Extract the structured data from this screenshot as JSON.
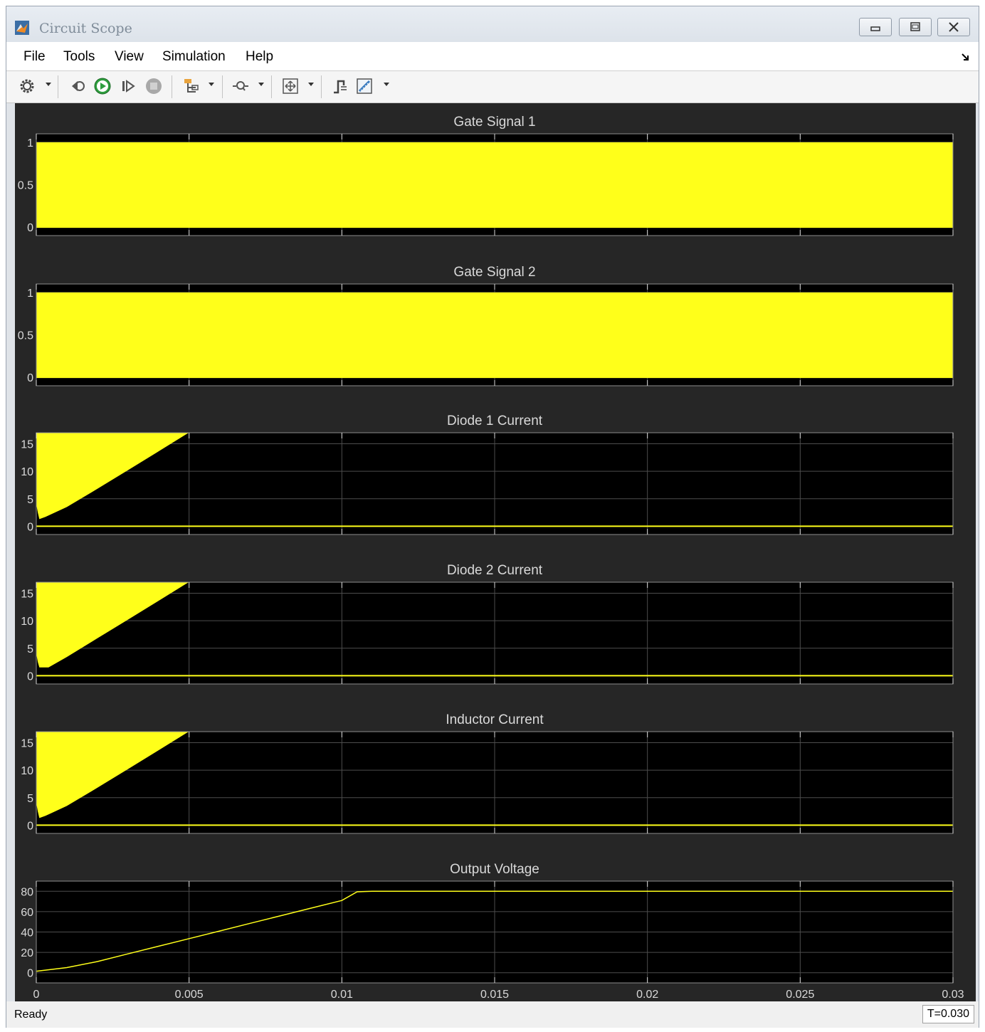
{
  "window": {
    "title": "Circuit Scope",
    "colors": {
      "plot_bg": "#000000",
      "figure_bg": "#262626",
      "signal": "#ffff1a",
      "grid": "#4d4d4d",
      "text": "#d9d9d9"
    }
  },
  "menu": {
    "items": [
      "File",
      "Tools",
      "View",
      "Simulation",
      "Help"
    ]
  },
  "toolbar": {
    "icons": [
      "gear-icon",
      "step-back-icon",
      "run-icon",
      "step-forward-icon",
      "stop-icon",
      "signal-select-icon",
      "zoom-icon",
      "autoscale-icon",
      "triggers-icon",
      "measurements-icon"
    ]
  },
  "status": {
    "ready": "Ready",
    "time": "T=0.030"
  },
  "chart_data": [
    {
      "type": "area",
      "title": "Gate Signal 1",
      "xlim": [
        0,
        0.03
      ],
      "ylim": [
        -0.1,
        1.1
      ],
      "yticks": [
        {
          "v": 0,
          "label": "0"
        },
        {
          "v": 0.5,
          "label": "0.5"
        },
        {
          "v": 1,
          "label": "1"
        }
      ],
      "series": [
        {
          "x": [
            0,
            0.03
          ],
          "upper": [
            1,
            1
          ],
          "lower": [
            0,
            0
          ]
        }
      ]
    },
    {
      "type": "area",
      "title": "Gate Signal 2",
      "xlim": [
        0,
        0.03
      ],
      "ylim": [
        -0.1,
        1.1
      ],
      "yticks": [
        {
          "v": 0,
          "label": "0"
        },
        {
          "v": 0.5,
          "label": "0.5"
        },
        {
          "v": 1,
          "label": "1"
        }
      ],
      "series": [
        {
          "x": [
            0,
            0.03
          ],
          "upper": [
            1,
            1
          ],
          "lower": [
            0,
            0
          ]
        }
      ]
    },
    {
      "type": "area",
      "title": "Diode 1 Current",
      "xlim": [
        0,
        0.03
      ],
      "ylim": [
        -1.5,
        17
      ],
      "yticks": [
        {
          "v": 0,
          "label": "0"
        },
        {
          "v": 5,
          "label": "5"
        },
        {
          "v": 10,
          "label": "10"
        },
        {
          "v": 15,
          "label": "15"
        }
      ],
      "series": [
        {
          "x": [
            0,
            5e-05,
            0.0001,
            0.0003,
            0.001,
            0.002,
            0.003,
            0.004,
            0.0049,
            0.005,
            0.03
          ],
          "upper": [
            17,
            17,
            17,
            17,
            17,
            17,
            17,
            17,
            17,
            17,
            17
          ],
          "lower": [
            4,
            2.5,
            1.3,
            1.7,
            3.5,
            6.8,
            10.2,
            13.6,
            16.7,
            17,
            17
          ]
        }
      ]
    },
    {
      "type": "area",
      "title": "Diode 2 Current",
      "xlim": [
        0,
        0.03
      ],
      "ylim": [
        -1.5,
        17
      ],
      "yticks": [
        {
          "v": 0,
          "label": "0"
        },
        {
          "v": 5,
          "label": "5"
        },
        {
          "v": 10,
          "label": "10"
        },
        {
          "v": 15,
          "label": "15"
        }
      ],
      "series": [
        {
          "x": [
            0,
            5e-05,
            0.0001,
            0.0004,
            0.001,
            0.002,
            0.003,
            0.004,
            0.0049,
            0.005,
            0.03
          ],
          "upper": [
            17,
            17,
            17,
            17,
            17,
            17,
            17,
            17,
            17,
            17,
            17
          ],
          "lower": [
            4,
            2.5,
            1.5,
            1.5,
            3.4,
            6.8,
            10.2,
            13.6,
            16.7,
            17,
            17
          ]
        }
      ]
    },
    {
      "type": "area",
      "title": "Inductor Current",
      "xlim": [
        0,
        0.03
      ],
      "ylim": [
        -1.5,
        17
      ],
      "yticks": [
        {
          "v": 0,
          "label": "0"
        },
        {
          "v": 5,
          "label": "5"
        },
        {
          "v": 10,
          "label": "10"
        },
        {
          "v": 15,
          "label": "15"
        }
      ],
      "series": [
        {
          "x": [
            0,
            5e-05,
            0.0001,
            0.0003,
            0.001,
            0.002,
            0.003,
            0.004,
            0.0049,
            0.005,
            0.03
          ],
          "upper": [
            17,
            17,
            17,
            17,
            17,
            17,
            17,
            17,
            17,
            17,
            17
          ],
          "lower": [
            4,
            2.5,
            1.3,
            1.7,
            3.5,
            6.8,
            10.2,
            13.6,
            16.7,
            17,
            17
          ]
        }
      ]
    },
    {
      "type": "line",
      "title": "Output Voltage",
      "xlim": [
        0,
        0.03
      ],
      "ylim": [
        -10,
        90
      ],
      "yticks": [
        {
          "v": 0,
          "label": "0"
        },
        {
          "v": 20,
          "label": "20"
        },
        {
          "v": 40,
          "label": "40"
        },
        {
          "v": 60,
          "label": "60"
        },
        {
          "v": 80,
          "label": "80"
        }
      ],
      "xticks": [
        {
          "v": 0,
          "label": "0"
        },
        {
          "v": 0.005,
          "label": "0.005"
        },
        {
          "v": 0.01,
          "label": "0.01"
        },
        {
          "v": 0.015,
          "label": "0.015"
        },
        {
          "v": 0.02,
          "label": "0.02"
        },
        {
          "v": 0.025,
          "label": "0.025"
        },
        {
          "v": 0.03,
          "label": "0.03"
        }
      ],
      "series": [
        {
          "x": [
            0,
            0.001,
            0.002,
            0.003,
            0.004,
            0.005,
            0.006,
            0.007,
            0.008,
            0.009,
            0.01,
            0.0105,
            0.011,
            0.03
          ],
          "y": [
            1.5,
            5,
            11,
            18.5,
            26,
            33.5,
            41,
            48.5,
            56,
            63.5,
            71,
            79.5,
            80,
            80
          ]
        }
      ]
    }
  ]
}
